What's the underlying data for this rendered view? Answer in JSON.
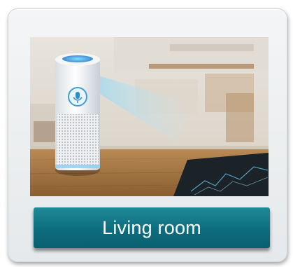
{
  "card": {
    "photo_subject": "smart-speaker-icon",
    "button_label": "Living room",
    "accent_color": "#0d6d7e"
  }
}
